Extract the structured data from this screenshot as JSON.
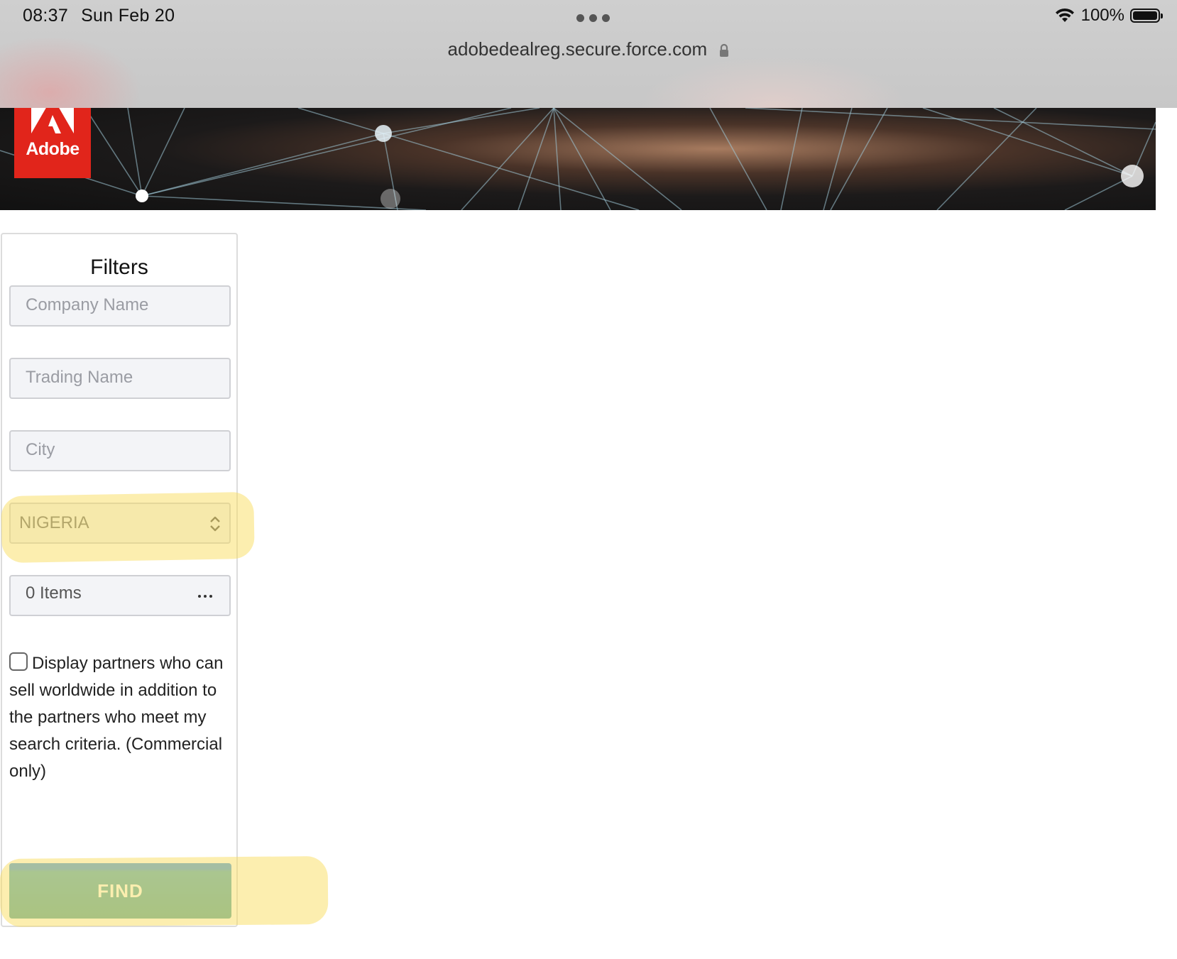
{
  "status_bar": {
    "time": "08:37",
    "date": "Sun Feb 20",
    "battery": "100%"
  },
  "browser": {
    "url": "adobedealreg.secure.force.com"
  },
  "banner": {
    "logo_text": "Adobe"
  },
  "filters": {
    "title": "Filters",
    "company_name_placeholder": "Company Name",
    "trading_name_placeholder": "Trading Name",
    "city_placeholder": "City",
    "country_value": "NIGERIA",
    "items_value": "0 Items",
    "worldwide_checkbox_checked": false,
    "worldwide_checkbox_label": "Display partners who can sell worldwide in addition to the partners who meet my search criteria. (Commercial only)",
    "find_button_label": "FIND"
  },
  "colors": {
    "adobe_red": "#e1251b",
    "find_button": "#5ca9a2",
    "highlight": "#fadd5f"
  }
}
